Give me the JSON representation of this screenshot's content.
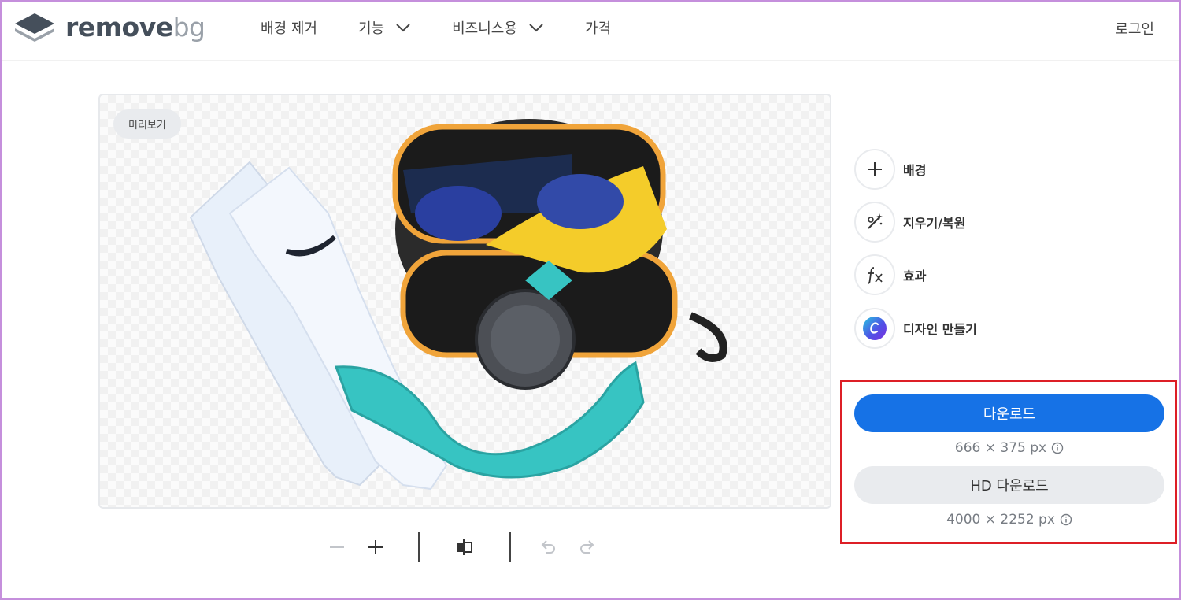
{
  "header": {
    "logo_main": "remove",
    "logo_accent": "bg",
    "nav": [
      {
        "label": "배경 제거",
        "has_dropdown": false
      },
      {
        "label": "기능",
        "has_dropdown": true
      },
      {
        "label": "비즈니스용",
        "has_dropdown": true
      },
      {
        "label": "가격",
        "has_dropdown": false
      }
    ],
    "login_label": "로그인"
  },
  "preview": {
    "badge": "미리보기"
  },
  "toolbar": {
    "icons": [
      "zoom-out-icon",
      "zoom-in-icon",
      "compare-icon",
      "undo-icon",
      "redo-icon"
    ]
  },
  "tools": [
    {
      "label": "배경",
      "icon": "plus-icon"
    },
    {
      "label": "지우기/복원",
      "icon": "magic-brush-icon"
    },
    {
      "label": "효과",
      "icon": "fx-icon"
    },
    {
      "label": "디자인 만들기",
      "icon": "canva-icon"
    }
  ],
  "download": {
    "primary_label": "다운로드",
    "primary_size": "666 × 375 px",
    "hd_label": "HD 다운로드",
    "hd_size": "4000 × 2252 px"
  },
  "colors": {
    "primary": "#1672e6",
    "highlight_border": "#dd1f26",
    "frame": "#c58fdc"
  }
}
